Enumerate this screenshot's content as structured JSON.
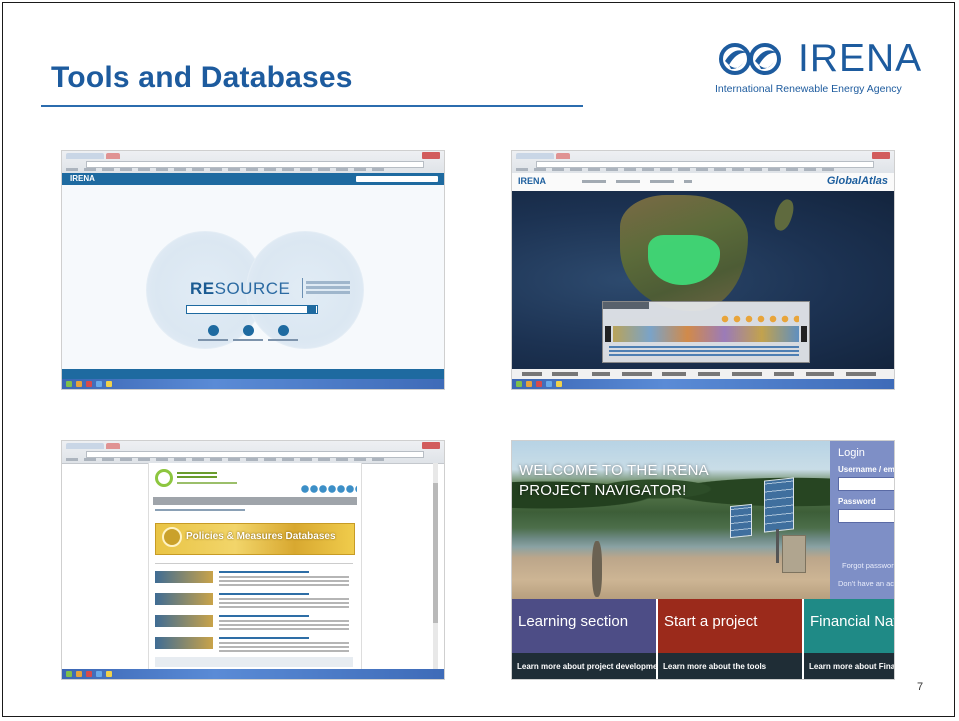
{
  "slide": {
    "title": "Tools and Databases",
    "page_number": "7"
  },
  "logo": {
    "word": "IRENA",
    "subtitle": "International Renewable Energy Agency"
  },
  "screenshots": {
    "resource": {
      "brand": "IRENA",
      "name_bold": "RE",
      "name_rest": "SOURCE"
    },
    "global_atlas": {
      "brand": "IRENA",
      "product": "GlobalAtlas"
    },
    "policies_db": {
      "banner_text": "Policies & Measures Databases"
    },
    "project_navigator": {
      "welcome": "WELCOME TO THE IRENA PROJECT NAVIGATOR!",
      "login_title": "Login",
      "username_label": "Username / emai",
      "password_label": "Password",
      "forgot_link": "Forgot passwor",
      "no_account_link": "Don't have an acc",
      "tiles": [
        {
          "label": "Learning section",
          "link": "Learn more about project development",
          "color": "#4d4d86"
        },
        {
          "label": "Start a project",
          "link": "Learn more about the tools",
          "color": "#9b2a1b"
        },
        {
          "label": "Financial Navi",
          "link": "Learn more about Financ",
          "color": "#1f8a86"
        }
      ]
    }
  },
  "colors": {
    "title_blue": "#1d5b9e",
    "rule_blue": "#2b6cae"
  }
}
